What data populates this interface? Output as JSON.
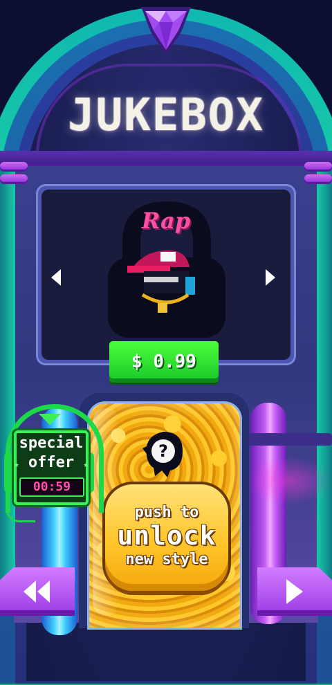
{
  "title": "JUKEBOX",
  "style_name": "Rap",
  "price_label": "$ 0.99",
  "special_offer": {
    "line1": "special",
    "line2": "offer",
    "star": "★",
    "timer": "00:59"
  },
  "unlock_button": {
    "line1": "push to",
    "line2": "unlock",
    "line3": "new style"
  },
  "mystery_symbol": "?",
  "colors": {
    "price_green": "#17c62a",
    "unlock_yellow": "#ffc52a",
    "nav_purple": "#9a3ae6",
    "timer_pink": "#ff4fa8",
    "title_pink": "#ff4fa3"
  }
}
